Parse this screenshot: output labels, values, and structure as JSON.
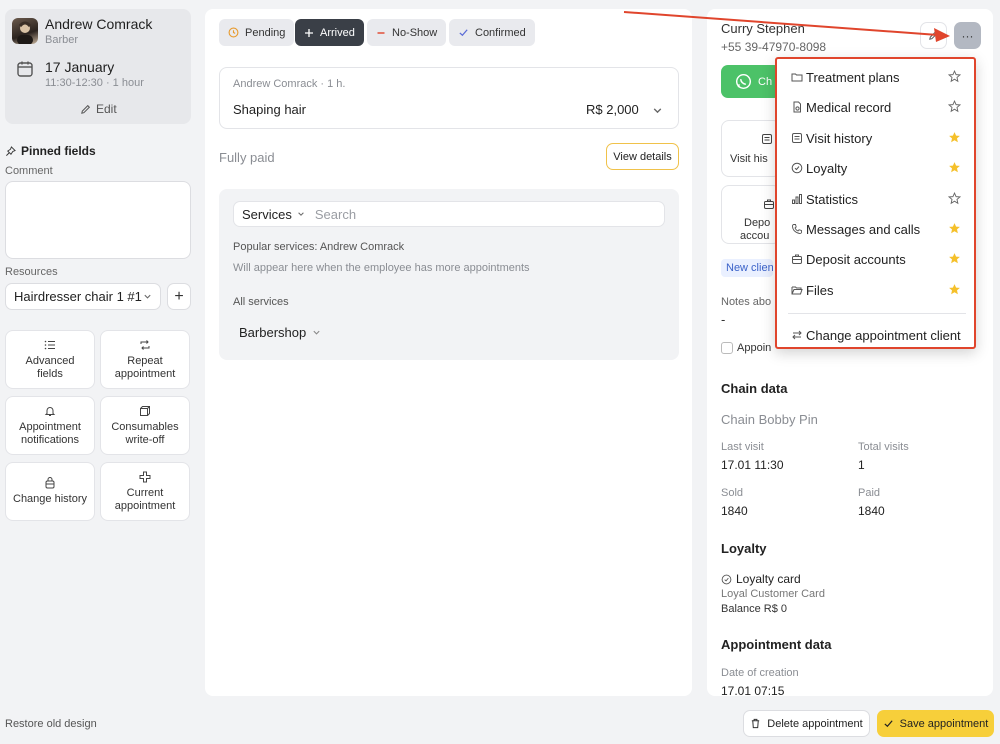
{
  "employee": {
    "name": "Andrew Comrack",
    "role": "Barber",
    "date": "17 January",
    "time": "11:30-12:30 · 1 hour",
    "edit_label": "Edit"
  },
  "left": {
    "pinned_label": "Pinned fields",
    "comment_label": "Comment",
    "comment_value": "",
    "resources_label": "Resources",
    "resource_value": "Hairdresser chair 1 #1",
    "resource_add": "+",
    "tiles": [
      {
        "label": "Advanced fields",
        "icon": "list-icon"
      },
      {
        "label": "Repeat appointment",
        "icon": "repeat-icon"
      },
      {
        "label": "Appointment notifications",
        "icon": "bell-icon"
      },
      {
        "label": "Consumables write-off",
        "icon": "box-icon"
      },
      {
        "label": "Change history",
        "icon": "history-icon"
      },
      {
        "label": "Current appointment",
        "icon": "plus-icon"
      }
    ],
    "restore_label": "Restore old design"
  },
  "statuses": {
    "pending": "Pending",
    "arrived": "Arrived",
    "no_show": "No-Show",
    "confirmed": "Confirmed"
  },
  "service": {
    "meta": "Andrew Comrack · 1 h.",
    "name": "Shaping hair",
    "price": "R$ 2,000",
    "paid_label": "Fully paid",
    "view_details": "View details",
    "services_dropdown": "Services",
    "search_placeholder": "Search",
    "popular_title": "Popular services: Andrew Comrack",
    "popular_hint": "Will appear here when the employee has more appointments",
    "all_services": "All services",
    "category": "Barbershop"
  },
  "client": {
    "name": "Curry Stephen",
    "phone": "+55 39-47970-8098",
    "whatsapp_label": "Ch",
    "tile_visit": "Visit his",
    "tile_deposit_1": "Depo",
    "tile_deposit_2": "accou",
    "new_client_badge": "New client",
    "notes_label": "Notes abo",
    "notes_value": "-",
    "appoint_checkbox": "Appoin",
    "more_label": "···"
  },
  "chain": {
    "title": "Chain data",
    "name": "Chain Bobby Pin",
    "last_visit_label": "Last visit",
    "last_visit_value": "17.01 11:30",
    "total_visits_label": "Total visits",
    "total_visits_value": "1",
    "sold_label": "Sold",
    "sold_value": "1840",
    "paid_label": "Paid",
    "paid_value": "1840"
  },
  "loyalty": {
    "title": "Loyalty",
    "card_title": "Loyalty card",
    "card_name": "Loyal Customer Card",
    "balance": "Balance R$ 0"
  },
  "appointment_data": {
    "title": "Appointment data",
    "created_label": "Date of creation",
    "created_value": "17.01 07:15"
  },
  "footer": {
    "delete_label": "Delete appointment",
    "save_label": "Save appointment"
  },
  "menu": {
    "items": [
      {
        "label": "Treatment plans",
        "icon": "folder-icon",
        "starred": false
      },
      {
        "label": "Medical record",
        "icon": "medical-record-icon",
        "starred": false
      },
      {
        "label": "Visit history",
        "icon": "visit-history-icon",
        "starred": true
      },
      {
        "label": "Loyalty",
        "icon": "loyalty-icon",
        "starred": true
      },
      {
        "label": "Statistics",
        "icon": "statistics-icon",
        "starred": false
      },
      {
        "label": "Messages and calls",
        "icon": "phone-icon",
        "starred": true
      },
      {
        "label": "Deposit accounts",
        "icon": "briefcase-icon",
        "starred": true
      },
      {
        "label": "Files",
        "icon": "folder-open-icon",
        "starred": true
      }
    ],
    "change_client": "Change appointment client"
  },
  "colors": {
    "accent_yellow": "#f7cf3a",
    "star_gold": "#f5c02a",
    "highlight_red": "#e0452c",
    "whatsapp_green": "#4cc268",
    "arrived_dark": "#3a3f47"
  }
}
